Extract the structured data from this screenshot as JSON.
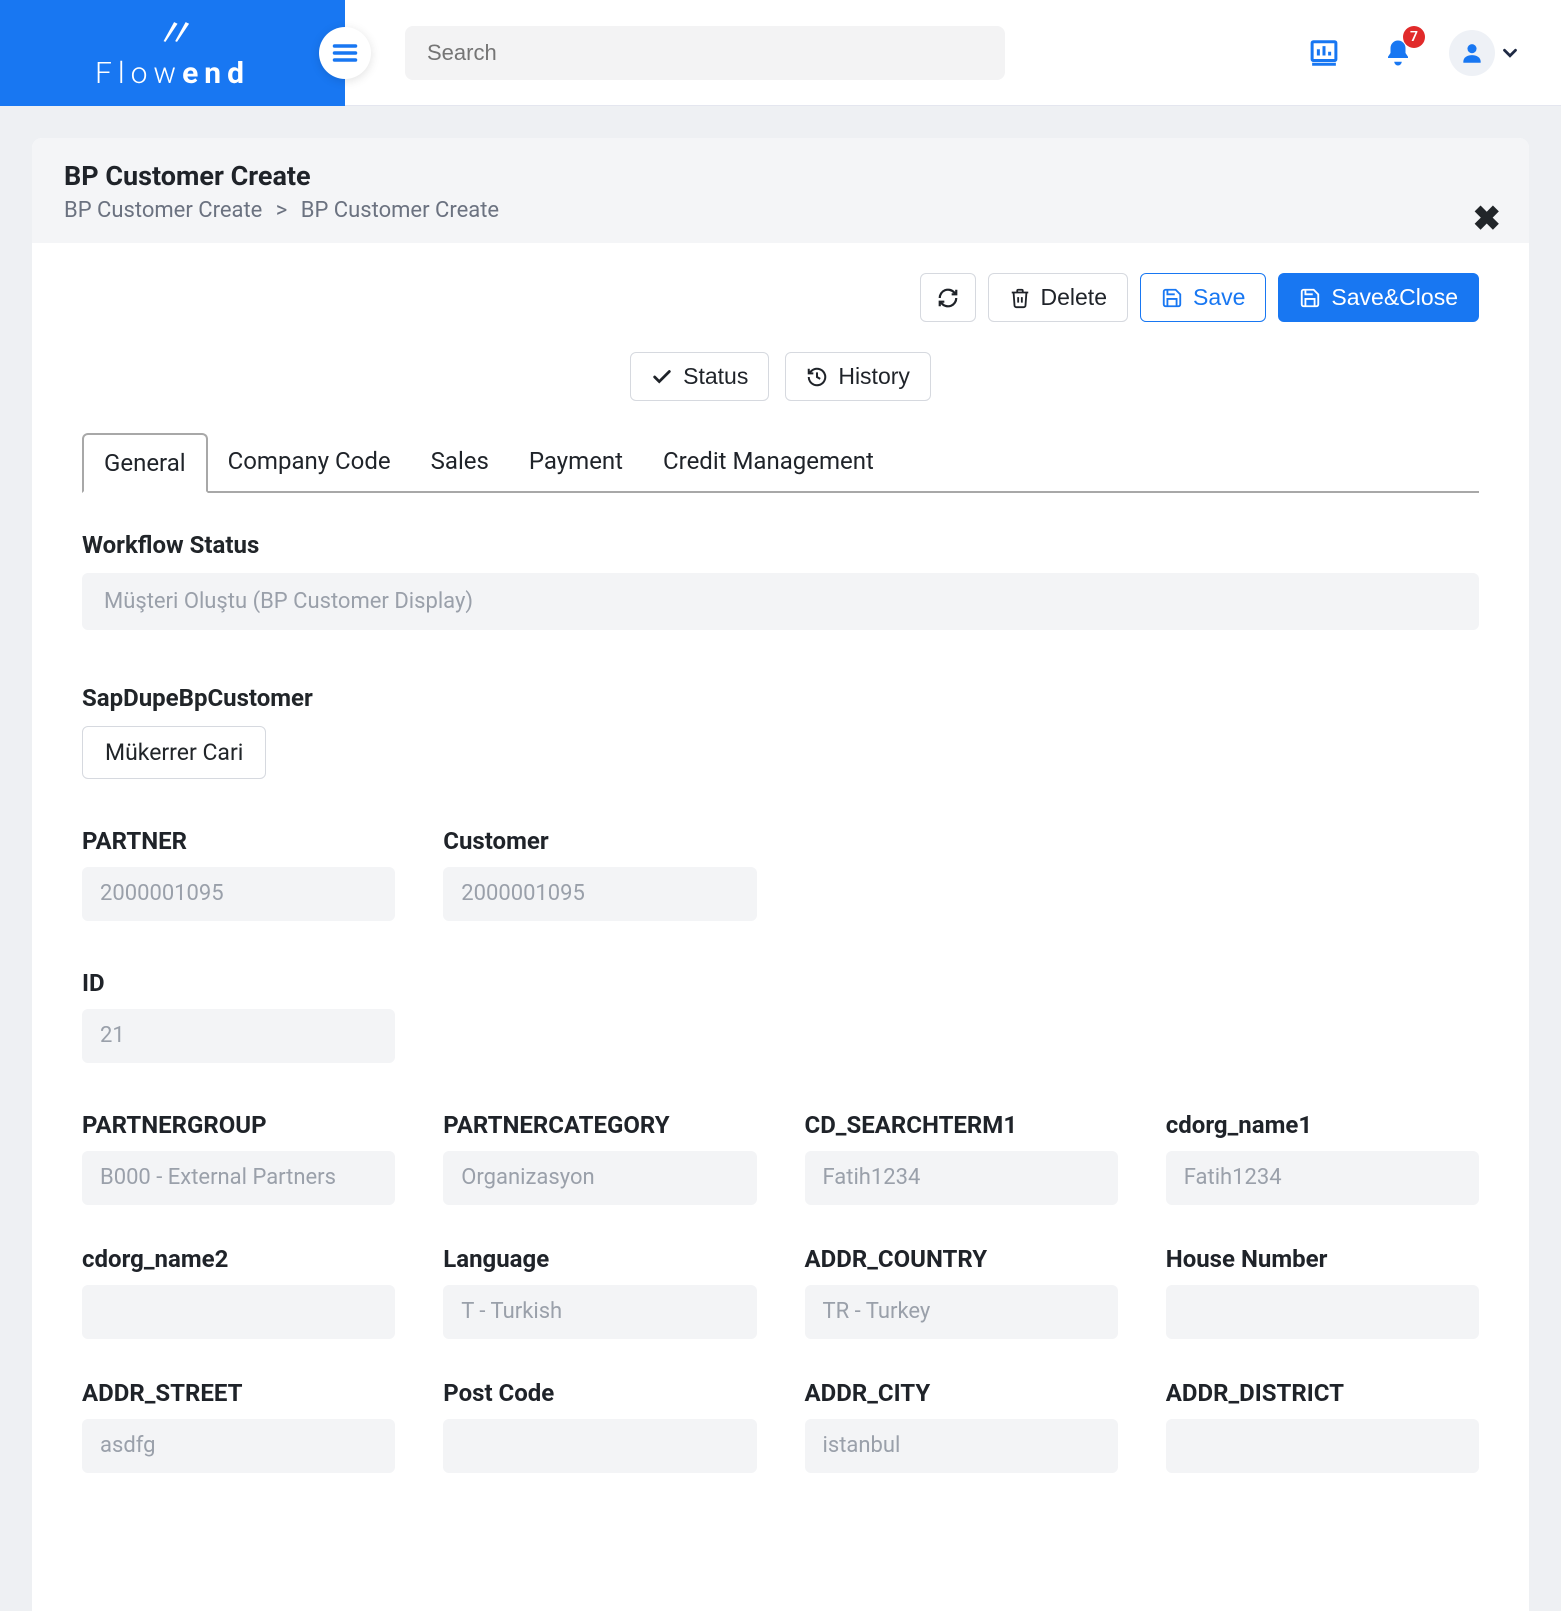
{
  "header": {
    "brand1": "Flow",
    "brand2": "end",
    "search_placeholder": "Search",
    "notification_count": "7"
  },
  "page": {
    "title": "BP Customer Create",
    "crumb1": "BP Customer Create",
    "crumb2": "BP Customer Create"
  },
  "actions": {
    "delete": "Delete",
    "save": "Save",
    "save_close": "Save&Close",
    "status": "Status",
    "history": "History"
  },
  "tabs": [
    "General",
    "Company Code",
    "Sales",
    "Payment",
    "Credit Management"
  ],
  "form": {
    "workflow_label": "Workflow Status",
    "workflow_value": "Müşteri Oluştu (BP Customer Display)",
    "sapdupe_label": "SapDupeBpCustomer",
    "sapdupe_btn": "Mükerrer Cari",
    "partner_label": "PARTNER",
    "partner_value": "2000001095",
    "customer_label": "Customer",
    "customer_value": "2000001095",
    "id_label": "ID",
    "id_value": "21",
    "fields": [
      {
        "label": "PARTNERGROUP",
        "value": "B000 - External Partners"
      },
      {
        "label": "PARTNERCATEGORY",
        "value": "Organizasyon"
      },
      {
        "label": "CD_SEARCHTERM1",
        "value": "Fatih1234"
      },
      {
        "label": "cdorg_name1",
        "value": "Fatih1234"
      },
      {
        "label": "cdorg_name2",
        "value": ""
      },
      {
        "label": "Language",
        "value": "T - Turkish"
      },
      {
        "label": "ADDR_COUNTRY",
        "value": "TR - Turkey"
      },
      {
        "label": "House Number",
        "value": ""
      },
      {
        "label": "ADDR_STREET",
        "value": "asdfg"
      },
      {
        "label": "Post Code",
        "value": ""
      },
      {
        "label": "ADDR_CITY",
        "value": "istanbul"
      },
      {
        "label": "ADDR_DISTRICT",
        "value": ""
      }
    ]
  }
}
